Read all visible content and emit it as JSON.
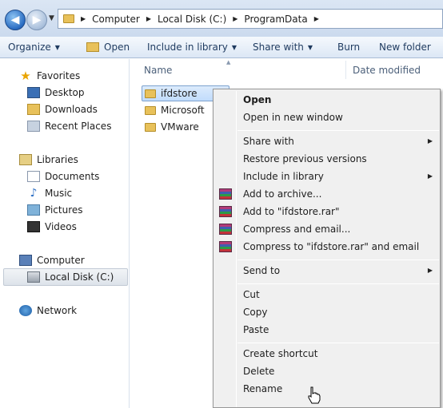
{
  "address_bar": {
    "crumbs": [
      "Computer",
      "Local Disk (C:)",
      "ProgramData"
    ]
  },
  "toolbar": {
    "organize": "Organize",
    "open": "Open",
    "include": "Include in library",
    "share": "Share with",
    "burn": "Burn",
    "new_folder": "New folder"
  },
  "nav": {
    "favorites": "Favorites",
    "desktop": "Desktop",
    "downloads": "Downloads",
    "recent": "Recent Places",
    "libraries": "Libraries",
    "documents": "Documents",
    "music": "Music",
    "pictures": "Pictures",
    "videos": "Videos",
    "computer": "Computer",
    "local_disk": "Local Disk (C:)",
    "network": "Network"
  },
  "columns": {
    "name": "Name",
    "date": "Date modified"
  },
  "files": [
    "ifdstore",
    "Microsoft",
    "VMware"
  ],
  "context_menu": {
    "open": "Open",
    "open_new": "Open in new window",
    "share_with": "Share with",
    "restore": "Restore previous versions",
    "include": "Include in library",
    "add_archive": "Add to archive...",
    "add_rar": "Add to \"ifdstore.rar\"",
    "compress_email": "Compress and email...",
    "compress_rar_email": "Compress to \"ifdstore.rar\" and email",
    "send_to": "Send to",
    "cut": "Cut",
    "copy": "Copy",
    "paste": "Paste",
    "create_shortcut": "Create shortcut",
    "delete": "Delete",
    "rename": "Rename"
  }
}
